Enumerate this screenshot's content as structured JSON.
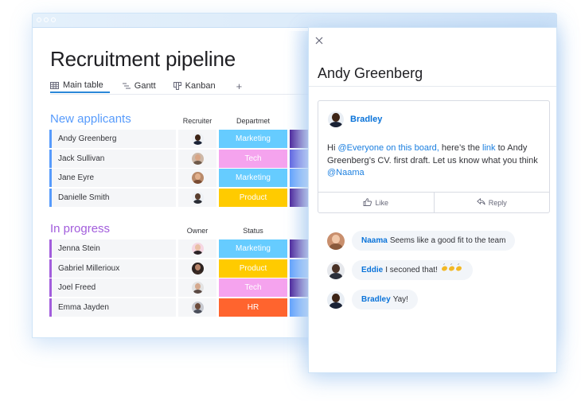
{
  "colors": {
    "accent_blue": "#2b88d8",
    "group_new": "#579bfc",
    "group_progress": "#a25ddc",
    "mention": "#1b7fe0",
    "author": "#0a73d9",
    "status": {
      "Marketing": "#66ccff",
      "Tech": "#f5a3ee",
      "Product": "#ffcb00",
      "HR": "#ff642e"
    },
    "extra": {
      "dark": "#401694",
      "indigo": "#5559df",
      "blue": "#579bfc"
    }
  },
  "board": {
    "title": "Recruitment pipeline",
    "tabs": [
      {
        "label": "Main table",
        "icon": "table-icon",
        "active": true
      },
      {
        "label": "Gantt",
        "icon": "gantt-icon",
        "active": false
      },
      {
        "label": "Kanban",
        "icon": "kanban-icon",
        "active": false
      }
    ],
    "add_tab_label": "+",
    "groups": [
      {
        "title": "New applicants",
        "person_column": "Recruiter",
        "status_column": "Departmet",
        "rows": [
          {
            "name": "Andy Greenberg",
            "status": "Marketing",
            "extra": "dark"
          },
          {
            "name": "Jack Sullivan",
            "status": "Tech",
            "extra": "indigo"
          },
          {
            "name": "Jane Eyre",
            "status": "Marketing",
            "extra": "blue"
          },
          {
            "name": "Danielle Smith",
            "status": "Product",
            "extra": "dark"
          }
        ]
      },
      {
        "title": "In progress",
        "person_column": "Owner",
        "status_column": "Status",
        "rows": [
          {
            "name": "Jenna Stein",
            "status": "Marketing",
            "extra": "dark"
          },
          {
            "name": "Gabriel Millerioux",
            "status": "Product",
            "extra": "blue"
          },
          {
            "name": "Joel Freed",
            "status": "Tech",
            "extra": "dark"
          },
          {
            "name": "Emma Jayden",
            "status": "HR",
            "extra": "blue"
          }
        ]
      }
    ]
  },
  "panel": {
    "close_icon": "close-icon",
    "title": "Andy Greenberg",
    "post": {
      "author": "Bradley",
      "body": {
        "t1": "Hi ",
        "m1": "@Everyone on this board,",
        "t2": " here’s the ",
        "m2": "link",
        "t3": " to Andy Greenberg’s CV. first draft. Let us know what you think ",
        "m3": "@Naama"
      },
      "like_label": "Like",
      "reply_label": "Reply"
    },
    "replies": [
      {
        "author": "Naama",
        "text": "Seems like a good fit to the team",
        "emoji": ""
      },
      {
        "author": "Eddie",
        "text": "I seconed that!",
        "emoji": "👏👏👏"
      },
      {
        "author": "Bradley",
        "text": "Yay!",
        "emoji": ""
      }
    ]
  }
}
